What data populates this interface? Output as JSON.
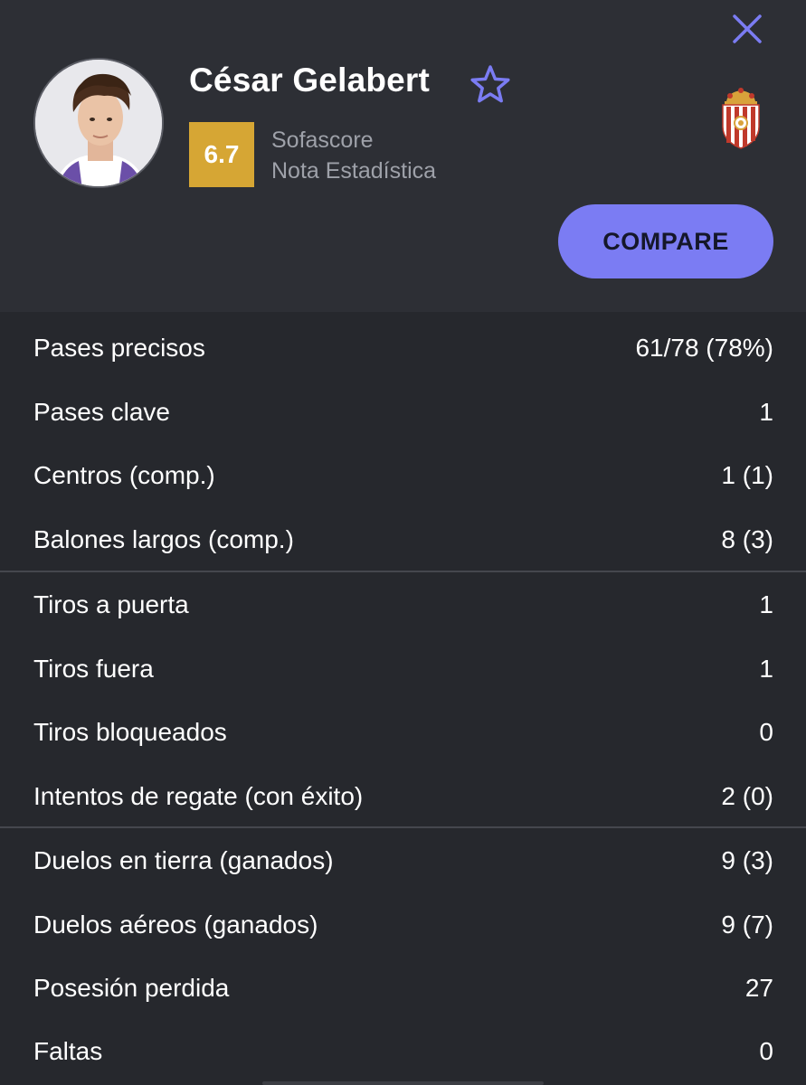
{
  "player": {
    "name": "César Gelabert",
    "rating": "6.7",
    "rating_source": "Sofascore",
    "rating_label": "Nota Estadística"
  },
  "icons": {
    "close": "close-icon",
    "favorite": "star-outline-icon",
    "team": "team-crest-icon"
  },
  "colors": {
    "accent": "#7b7cf3",
    "rating_badge": "#d6a634",
    "background": "#26282d",
    "header_background": "#2d2f35"
  },
  "compare_label": "COMPARE",
  "stats": [
    {
      "label": "Pases precisos",
      "value": "61/78 (78%)"
    },
    {
      "label": "Pases clave",
      "value": "1"
    },
    {
      "label": "Centros (comp.)",
      "value": "1 (1)"
    },
    {
      "label": "Balones largos (comp.)",
      "value": "8 (3)"
    },
    {
      "label": "Tiros a puerta",
      "value": "1"
    },
    {
      "label": "Tiros fuera",
      "value": "1"
    },
    {
      "label": "Tiros bloqueados",
      "value": "0"
    },
    {
      "label": "Intentos de regate (con éxito)",
      "value": "2 (0)"
    },
    {
      "label": "Duelos en tierra (ganados)",
      "value": "9 (3)"
    },
    {
      "label": "Duelos aéreos (ganados)",
      "value": "9 (7)"
    },
    {
      "label": "Posesión perdida",
      "value": "27"
    },
    {
      "label": "Faltas",
      "value": "0"
    }
  ]
}
